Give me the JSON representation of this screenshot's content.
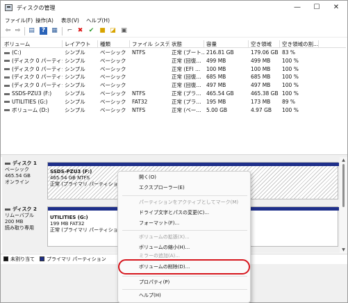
{
  "window": {
    "title": "ディスクの管理",
    "minimize": "—",
    "maximize": "☐",
    "close": "✕"
  },
  "menu": [
    "ファイル(F)",
    "操作(A)",
    "表示(V)",
    "ヘルプ(H)"
  ],
  "toolbar": {
    "icons": [
      "back-icon",
      "forward-icon",
      "disk-list-icon",
      "help-icon",
      "volume-list-icon",
      "connect-icon",
      "delete-icon",
      "checkmark-icon",
      "new-disk-icon",
      "search-disk-icon",
      "properties-icon"
    ]
  },
  "volume_list": {
    "columns": [
      "ボリューム",
      "レイアウト",
      "種類",
      "ファイル システム",
      "状態",
      "容量",
      "空き領域",
      "空き領域の割..."
    ],
    "rows": [
      [
        "(C:)",
        "シンプル",
        "ベーシック",
        "NTFS",
        "正常 (ブート...",
        "216.81 GB",
        "179.06 GB",
        "83 %"
      ],
      [
        "(ディスク 0 パーティシ...",
        "シンプル",
        "ベーシック",
        "",
        "正常 (回復...",
        "499 MB",
        "499 MB",
        "100 %"
      ],
      [
        "(ディスク 0 パーティシ...",
        "シンプル",
        "ベーシック",
        "",
        "正常 (EFI ...",
        "100 MB",
        "100 MB",
        "100 %"
      ],
      [
        "(ディスク 0 パーティシ...",
        "シンプル",
        "ベーシック",
        "",
        "正常 (回復...",
        "685 MB",
        "685 MB",
        "100 %"
      ],
      [
        "(ディスク 0 パーティシ...",
        "シンプル",
        "ベーシック",
        "",
        "正常 (回復...",
        "497 MB",
        "497 MB",
        "100 %"
      ],
      [
        "SSDS-PZU3 (F:)",
        "シンプル",
        "ベーシック",
        "NTFS",
        "正常 (プラ...",
        "465.54 GB",
        "465.38 GB",
        "100 %"
      ],
      [
        "UTILITIES (G:)",
        "シンプル",
        "ベーシック",
        "FAT32",
        "正常 (プラ...",
        "195 MB",
        "173 MB",
        "89 %"
      ],
      [
        "ボリューム (D:)",
        "シンプル",
        "ベーシック",
        "NTFS",
        "正常 (ベー...",
        "5.00 GB",
        "4.97 GB",
        "100 %"
      ]
    ]
  },
  "disks": [
    {
      "title": "ディスク 1",
      "type": "ベーシック",
      "size": "465.54 GB",
      "status": "オンライン",
      "partition": {
        "name": "SSDS-PZU3  (F:)",
        "size_fs": "465.54 GB NTFS",
        "status": "正常 (プライマリ パーティション)"
      }
    },
    {
      "title": "ディスク 2",
      "type": "リムーバブル",
      "size": "200 MB",
      "status": "読み取り専用",
      "partition": {
        "name": "UTILITIES  (G:)",
        "size_fs": "199 MB FAT32",
        "status": "正常 (プライマリ パーティション)"
      }
    }
  ],
  "legend": [
    {
      "label": "未割り当て",
      "color": "#111111"
    },
    {
      "label": "プライマリ パーティション",
      "color": "#1e2f8a"
    }
  ],
  "context_menu": {
    "items": [
      {
        "label": "開く(O)",
        "enabled": true
      },
      {
        "label": "エクスプローラー(E)",
        "enabled": true
      },
      {
        "label": "パーティションをアクティブとしてマーク(M)",
        "enabled": false
      },
      {
        "label": "ドライブ文字とパスの変更(C)...",
        "enabled": true
      },
      {
        "label": "フォーマット(F)...",
        "enabled": true
      },
      {
        "label": "ボリュームの拡張(X)...",
        "enabled": false
      },
      {
        "label": "ボリュームの縮小(H)...",
        "enabled": true
      },
      {
        "label": "ミラーの追加(A)...",
        "enabled": false
      },
      {
        "label": "ボリュームの削除(D)...",
        "enabled": true
      },
      {
        "label": "プロパティ(P)",
        "enabled": true
      },
      {
        "label": "ヘルプ(H)",
        "enabled": true
      }
    ]
  },
  "colors": {
    "partition_bar": "#1e2f8a",
    "highlight": "#d6161d"
  }
}
